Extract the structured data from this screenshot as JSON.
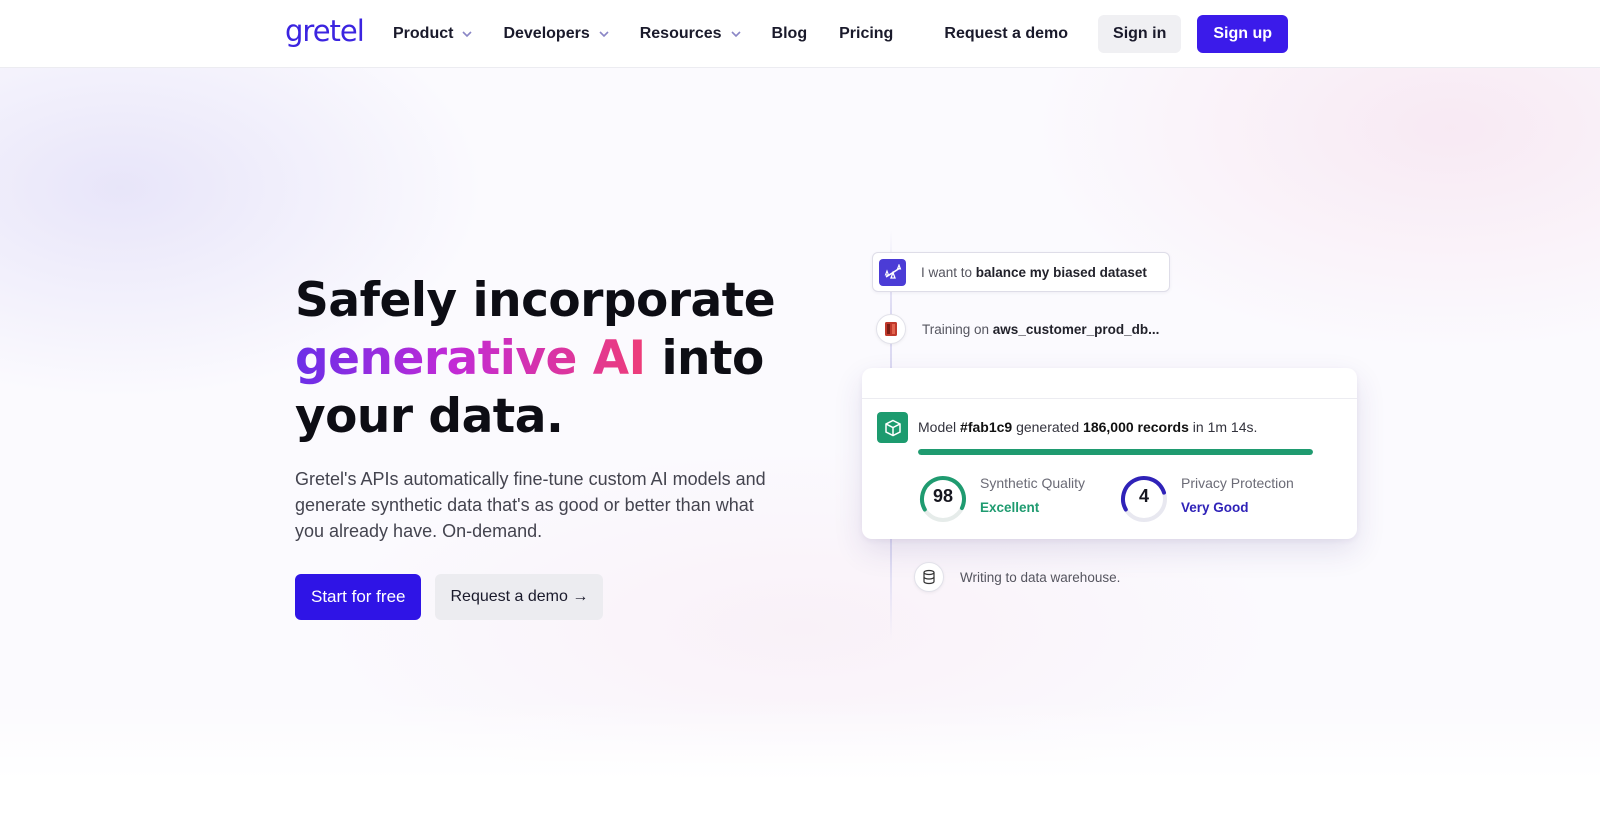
{
  "nav": {
    "logo": "gretel",
    "items": [
      {
        "label": "Product",
        "dropdown": true
      },
      {
        "label": "Developers",
        "dropdown": true
      },
      {
        "label": "Resources",
        "dropdown": true
      },
      {
        "label": "Blog",
        "dropdown": false
      },
      {
        "label": "Pricing",
        "dropdown": false
      }
    ],
    "request_demo": "Request a demo",
    "sign_in": "Sign in",
    "sign_up": "Sign up"
  },
  "hero": {
    "headline_line1": "Safely incorporate",
    "headline_highlight": "generative AI",
    "headline_line2_rest": " into",
    "headline_line3": "your data.",
    "subcopy": "Gretel's APIs automatically fine-tune custom AI models and generate synthetic data that's as good or better than what you already have. On-demand.",
    "cta_primary": "Start for free",
    "cta_secondary": "Request a demo →"
  },
  "workflow": {
    "prompt_prefix": "I want to ",
    "prompt_bold": "balance my biased dataset",
    "training_prefix": "Training on ",
    "training_bold": "aws_customer_prod_db...",
    "model": {
      "prefix": "Model ",
      "id": "#fab1c9",
      "mid": " generated ",
      "records": "186,000 records",
      "suffix": " in 1m 14s.",
      "progress": 1.0
    },
    "metrics": [
      {
        "value": "98",
        "label": "Synthetic Quality",
        "rating": "Excellent",
        "color": "#1f9b70",
        "fraction": 0.98
      },
      {
        "value": "4",
        "label": "Privacy Protection",
        "rating": "Very Good",
        "color": "#2f22b8",
        "fraction": 0.8
      }
    ],
    "write_step": "Writing to data warehouse."
  },
  "colors": {
    "brand": "#3b1bea",
    "success": "#1f9b70"
  }
}
